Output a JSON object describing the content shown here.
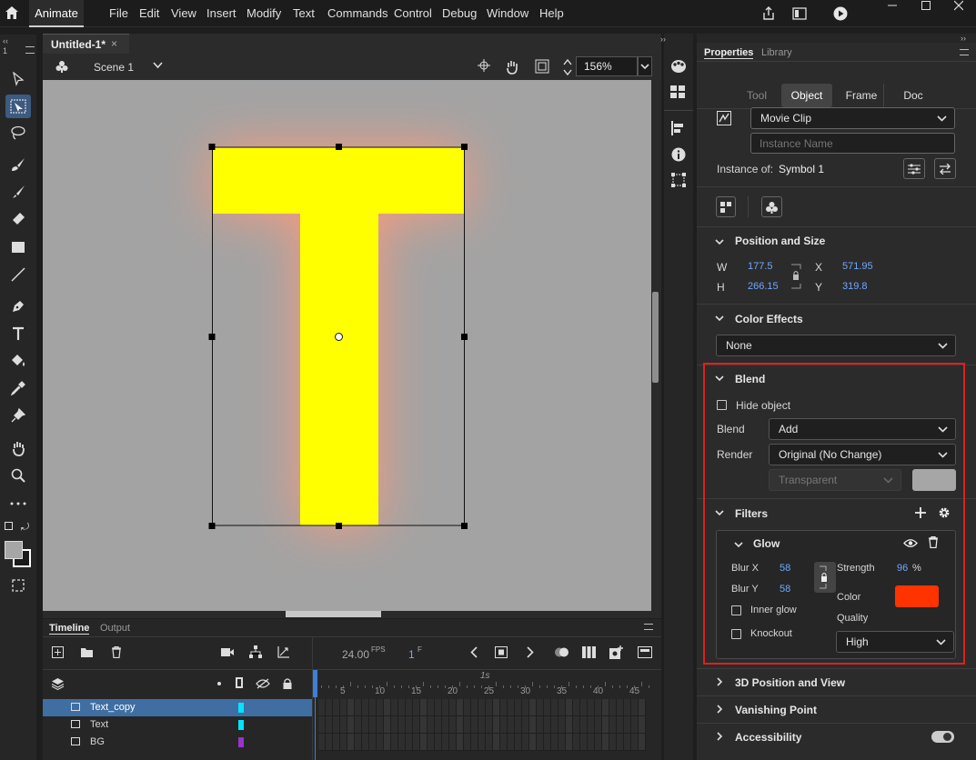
{
  "app": {
    "name": "Animate"
  },
  "menu": [
    "File",
    "Edit",
    "View",
    "Insert",
    "Modify",
    "Text",
    "Commands",
    "Control",
    "Debug",
    "Window",
    "Help"
  ],
  "document": {
    "tab_title": "Untitled-1*",
    "scene": "Scene 1",
    "zoom": "156%"
  },
  "timeline": {
    "tabs": [
      "Timeline",
      "Output"
    ],
    "fps": "24.00",
    "fps_unit": "FPS",
    "frame": "1",
    "frame_unit": "F",
    "seconds_label": "1s",
    "ruler": [
      "5",
      "10",
      "15",
      "20",
      "25",
      "30",
      "35",
      "40",
      "45"
    ],
    "layers": [
      {
        "name": "Text_copy",
        "color": "#00e5ff",
        "selected": true
      },
      {
        "name": "Text",
        "color": "#00e5ff",
        "selected": false
      },
      {
        "name": "BG",
        "color": "#9933cc",
        "selected": false
      }
    ]
  },
  "panel_tabs": [
    "Properties",
    "Library"
  ],
  "props": {
    "tabs": [
      "Tool",
      "Object",
      "Frame",
      "Doc"
    ],
    "active_tab": "Object",
    "symbol_type": "Movie Clip",
    "instance_name_placeholder": "Instance Name",
    "instance_of_label": "Instance of:",
    "instance_of_value": "Symbol 1",
    "position_size": {
      "title": "Position and Size",
      "w_label": "W",
      "w": "177.5",
      "h_label": "H",
      "h": "266.15",
      "x_label": "X",
      "x": "571.95",
      "y_label": "Y",
      "y": "319.8"
    },
    "color_effects": {
      "title": "Color Effects",
      "value": "None"
    },
    "blend": {
      "title": "Blend",
      "hide_object": "Hide object",
      "blend_label": "Blend",
      "blend_value": "Add",
      "render_label": "Render",
      "render_value": "Original (No Change)",
      "transparent": "Transparent",
      "swatch_color": "#a6a6a6"
    },
    "filters": {
      "title": "Filters",
      "glow": {
        "title": "Glow",
        "blur_x_label": "Blur X",
        "blur_x": "58",
        "blur_y_label": "Blur Y",
        "blur_y": "58",
        "strength_label": "Strength",
        "strength": "96",
        "strength_unit": "%",
        "color_label": "Color",
        "color": "#ff3300",
        "quality_label": "Quality",
        "quality": "High",
        "inner_glow": "Inner glow",
        "knockout": "Knockout"
      }
    },
    "collapsed": [
      "3D Position and View",
      "Vanishing Point",
      "Accessibility"
    ]
  },
  "stage": {
    "bg_color": "#a3a3a3",
    "letter_color": "#ffff00",
    "glow_color": "#ff9a7a"
  },
  "highlight_color": "#e0201c"
}
